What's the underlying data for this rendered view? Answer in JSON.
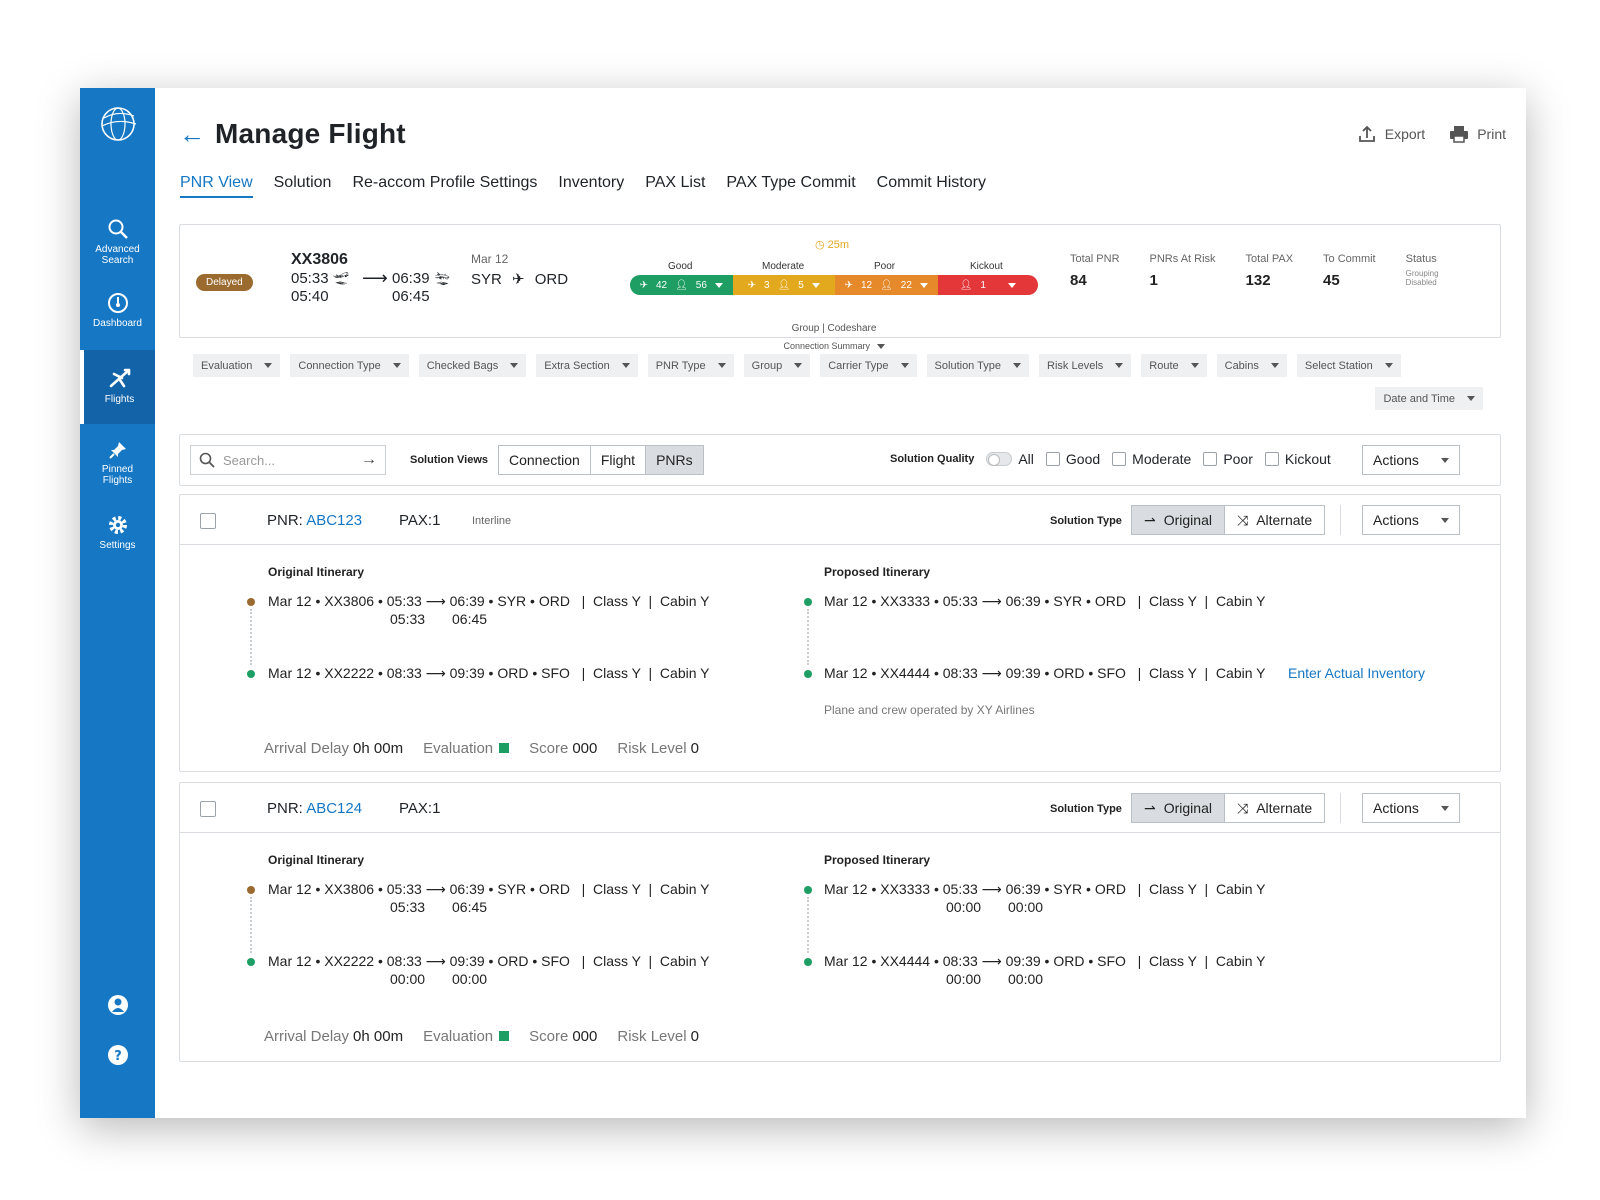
{
  "sidebar": {
    "items": [
      {
        "label": "Advanced Search",
        "icon": "search-icon"
      },
      {
        "label": "Dashboard",
        "icon": "dashboard-icon"
      },
      {
        "label": "Flights",
        "icon": "plane-icon",
        "active": true
      },
      {
        "label": "Pinned Flights",
        "icon": "pin-icon"
      },
      {
        "label": "Settings",
        "icon": "gear-icon"
      }
    ]
  },
  "header": {
    "title": "Manage Flight",
    "export_label": "Export",
    "print_label": "Print"
  },
  "tabs": [
    "PNR View",
    "Solution",
    "Re-accom Profile Settings",
    "Inventory",
    "PAX List",
    "PAX Type Commit",
    "Commit History"
  ],
  "flight": {
    "status": "Delayed",
    "number": "XX3806",
    "dep_sched": "05:33",
    "dep_actual": "05:40",
    "arr_sched": "06:39",
    "arr_actual": "06:45",
    "date": "Mar 12",
    "origin": "SYR",
    "destination": "ORD",
    "delay": "25m",
    "quality_labels": [
      "Good",
      "Moderate",
      "Poor",
      "Kickout"
    ],
    "good_flights": "42",
    "good_pax": "56",
    "moderate_flights": "3",
    "moderate_pax": "5",
    "poor_flights": "12",
    "poor_pax": "22",
    "kickout_pax": "1",
    "group_codeshare": "Group | Codeshare",
    "connection_summary": "Connection Summary",
    "stats": [
      {
        "label": "Total PNR",
        "value": "84"
      },
      {
        "label": "PNRs At Risk",
        "value": "1"
      },
      {
        "label": "Total PAX",
        "value": "132"
      },
      {
        "label": "To Commit",
        "value": "45"
      }
    ],
    "status_label": "Status",
    "status_sub_1": "Grouping",
    "status_sub_2": "Disabled"
  },
  "filters": [
    "Evaluation",
    "Connection Type",
    "Checked Bags",
    "Extra Section",
    "PNR Type",
    "Group",
    "Carrier Type",
    "Solution Type",
    "Risk Levels",
    "Route",
    "Cabins",
    "Select Station",
    "Date and Time"
  ],
  "toolbar": {
    "search_placeholder": "Search...",
    "solution_views_label": "Solution Views",
    "views": [
      "Connection",
      "Flight",
      "PNRs"
    ],
    "solution_quality_label": "Solution Quality",
    "all_label": "All",
    "quality_checks": [
      "Good",
      "Moderate",
      "Poor",
      "Kickout"
    ],
    "actions_label": "Actions"
  },
  "common": {
    "pnr_prefix": "PNR:",
    "solution_type_label": "Solution Type",
    "original_label": "Original",
    "alternate_label": "Alternate",
    "actions_label": "Actions",
    "original_itinerary": "Original Itinerary",
    "proposed_itinerary": "Proposed Itinerary",
    "arrival_delay_label": "Arrival Delay",
    "evaluation_label": "Evaluation",
    "score_label": "Score",
    "risk_level_label": "Risk Level"
  },
  "pnrs": [
    {
      "code": "ABC123",
      "pax": "PAX:1",
      "tag": "Interline",
      "orig_leg1": "Mar 12 • XX3806 • 05:33 ⟶ 06:39 • SYR • ORD   |  Class Y  |  Cabin Y",
      "orig_leg1_sub_dep": "05:33",
      "orig_leg1_sub_arr": "06:45",
      "orig_leg2": "Mar 12 • XX2222 • 08:33 ⟶ 09:39 • ORD • SFO   |  Class Y  |  Cabin Y",
      "prop_leg1": "Mar 12 • XX3333 • 05:33 ⟶ 06:39 • SYR • ORD   |  Class Y  |  Cabin Y",
      "prop_leg2": "Mar 12 • XX4444 • 08:33 ⟶ 09:39 • ORD • SFO   |  Class Y  |  Cabin Y",
      "enter_inventory": "Enter Actual Inventory",
      "note": "Plane and crew operated by XY Airlines",
      "arrival_delay": "0h 00m",
      "score": "000",
      "risk_level": "0"
    },
    {
      "code": "ABC124",
      "pax": "PAX:1",
      "orig_leg1": "Mar 12 • XX3806 • 05:33 ⟶ 06:39 • SYR • ORD   |  Class Y  |  Cabin Y",
      "orig_leg1_sub_dep": "05:33",
      "orig_leg1_sub_arr": "06:45",
      "orig_leg2": "Mar 12 • XX2222 • 08:33 ⟶ 09:39 • ORD • SFO   |  Class Y  |  Cabin Y",
      "orig_leg2_sub_dep": "00:00",
      "orig_leg2_sub_arr": "00:00",
      "prop_leg1": "Mar 12 • XX3333 • 05:33 ⟶ 06:39 • SYR • ORD   |  Class Y  |  Cabin Y",
      "prop_leg1_sub_dep": "00:00",
      "prop_leg1_sub_arr": "00:00",
      "prop_leg2": "Mar 12 • XX4444 • 08:33 ⟶ 09:39 • ORD • SFO   |  Class Y  |  Cabin Y",
      "prop_leg2_sub_dep": "00:00",
      "prop_leg2_sub_arr": "00:00",
      "arrival_delay": "0h 00m",
      "score": "000",
      "risk_level": "0"
    }
  ],
  "colors": {
    "primary": "#1677c4",
    "good": "#1e9e62",
    "moderate": "#e2a91f",
    "poor": "#e5892b",
    "kickout": "#e3373a",
    "delayed": "#9b6a2e"
  }
}
